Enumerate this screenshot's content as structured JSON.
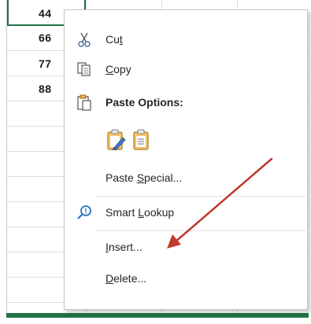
{
  "sheet": {
    "cells": [
      "44",
      "66",
      "77",
      "88"
    ]
  },
  "menu": {
    "cut": {
      "before": "Cu",
      "ul": "t",
      "after": ""
    },
    "copy": {
      "before": "",
      "ul": "C",
      "after": "opy"
    },
    "paste_options": "Paste Options:",
    "paste_special": {
      "before": "Paste ",
      "ul": "S",
      "after": "pecial..."
    },
    "smart_lookup": {
      "before": "Smart ",
      "ul": "L",
      "after": "ookup"
    },
    "insert": {
      "before": "",
      "ul": "I",
      "after": "nsert..."
    },
    "delete": {
      "before": "",
      "ul": "D",
      "after": "elete..."
    }
  },
  "colors": {
    "excel_green": "#217346",
    "annotation_arrow": "#c0392b"
  },
  "icons": [
    "scissors-icon",
    "copy-icon",
    "clipboard-icon",
    "paste-formatting-icon",
    "paste-values-icon",
    "smart-lookup-icon"
  ]
}
